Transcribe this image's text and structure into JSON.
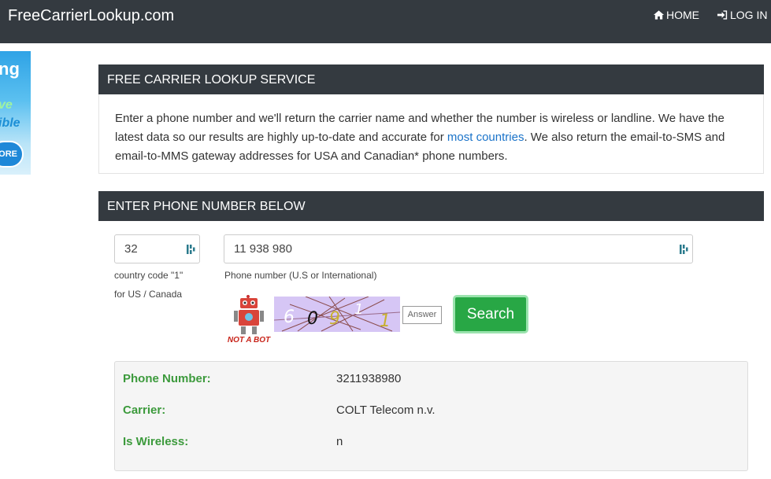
{
  "navbar": {
    "brand": "FreeCarrierLookup.com",
    "home_label": "HOME",
    "login_label": "LOG IN"
  },
  "ad": {
    "line1": "ng",
    "line2": "ve",
    "line3": "ible",
    "button": "ORE"
  },
  "service_panel": {
    "title": "FREE CARRIER LOOKUP SERVICE",
    "text_before_link": "Enter a phone number and we'll return the carrier name and whether the number is wireless or landline. We have the latest data so our results are highly up-to-date and accurate for ",
    "link_text": "most countries",
    "text_after_link": ". We also return the email-to-SMS and email-to-MMS gateway addresses for USA and Canadian* phone numbers."
  },
  "form_panel": {
    "title": "ENTER PHONE NUMBER BELOW",
    "country_code_value": "32",
    "country_code_help_line1": "country code \"1\"",
    "country_code_help_line2": "for US / Canada",
    "phone_value": "11 938 980",
    "phone_help": "Phone number (U.S or International)",
    "robot_caption": "NOT A BOT",
    "captcha_chars": [
      "6",
      "0",
      "9",
      "1",
      "1"
    ],
    "answer_placeholder": "Answer",
    "search_label": "Search"
  },
  "results": {
    "rows": [
      {
        "label": "Phone Number:",
        "value": "3211938980"
      },
      {
        "label": "Carrier:",
        "value": "COLT Telecom n.v."
      },
      {
        "label": "Is Wireless:",
        "value": "n"
      }
    ]
  },
  "colors": {
    "navbar": "#343a40",
    "panel_header": "#343a40",
    "search_button": "#28a745",
    "result_label": "#3c9a3c",
    "link": "#1a73c9"
  }
}
